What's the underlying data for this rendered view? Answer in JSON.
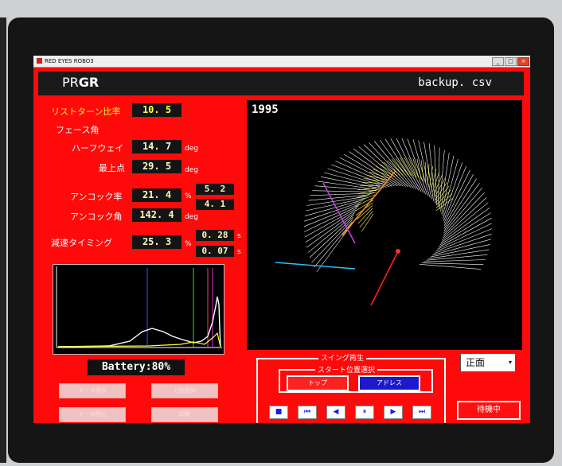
{
  "window": {
    "title": "RED EYES ROBO3",
    "min_label": "_",
    "max_label": "□",
    "close_label": "×"
  },
  "header": {
    "brand_light": "PR",
    "brand_bold": "GR",
    "filename": "backup. csv"
  },
  "metrics": {
    "wrist_turn_label": "リストターン比率",
    "wrist_turn_value": "10. 5",
    "face_angle_label": "フェース角",
    "halfway_label": "ハーフウェイ",
    "halfway_value": "14. 7",
    "halfway_unit": "deg",
    "top_label": "最上点",
    "top_value": "29. 5",
    "top_unit": "deg",
    "uncock_rate_label": "アンコック率",
    "uncock_rate_value": "21. 4",
    "uncock_rate_unit": "%",
    "uncock_side1": "5. 2",
    "uncock_side2": "4. 1",
    "uncock_angle_label": "アンコック角",
    "uncock_angle_value": "142. 4",
    "uncock_angle_unit": "deg",
    "decel_label": "減速タイミング",
    "decel_value": "25. 3",
    "decel_unit": "%",
    "decel_side1": "0. 28",
    "decel_side1_unit": "s",
    "decel_side2": "0. 07",
    "decel_side2_unit": "s"
  },
  "viewer": {
    "year": "1995"
  },
  "battery": "Battery:80%",
  "data_buttons": {
    "save": "データ保存",
    "delete": "分析削除",
    "load": "データ呼出",
    "print": "印刷"
  },
  "swing": {
    "title": "スイング再生",
    "start_title": "スタート位置選択",
    "top_btn": "トップ",
    "address_btn": "アドレス",
    "controls": {
      "stop": "■",
      "first": "⏮",
      "prev": "◀",
      "pause": "⏸",
      "next": "▶",
      "last": "⏭"
    }
  },
  "view_select": {
    "value": "正面",
    "arrow": "▾"
  },
  "status_button": "待機中",
  "colors": {
    "panel": "#ff0a0a",
    "dark": "#141414",
    "highlight": "#1a1acc"
  }
}
